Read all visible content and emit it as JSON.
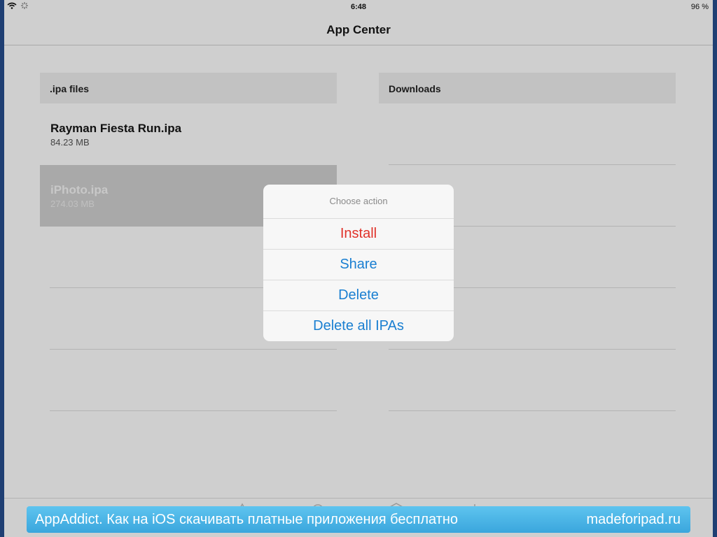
{
  "status_bar": {
    "time": "6:48",
    "battery": "96 %",
    "icons": [
      "wifi-icon",
      "activity-icon"
    ]
  },
  "navbar": {
    "title": "App Center"
  },
  "ipa_section": {
    "header": ".ipa files",
    "files": [
      {
        "name": "Rayman Fiesta Run.ipa",
        "size": "84.23 MB",
        "selected": false
      },
      {
        "name": "iPhoto.ipa",
        "size": "274.03 MB",
        "selected": true
      }
    ]
  },
  "downloads_section": {
    "header": "Downloads"
  },
  "action_sheet": {
    "title": "Choose action",
    "actions": [
      {
        "label": "Install",
        "style": "destructive"
      },
      {
        "label": "Share",
        "style": "default"
      },
      {
        "label": "Delete",
        "style": "default"
      },
      {
        "label": "Delete all IPAs",
        "style": "default"
      }
    ]
  },
  "tab_bar": {
    "icons": [
      "triangle-tab-icon",
      "circle-tab-icon",
      "hexagon-tab-icon",
      "plus-tab-icon"
    ]
  },
  "banner": {
    "left_text": "AppAddict. Как на iOS скачивать платные приложения бесплатно",
    "right_text": "madeforipad.ru"
  },
  "colors": {
    "accent": "#1a7fd1",
    "destructive": "#e0322a",
    "banner": "#4ab5e8"
  }
}
